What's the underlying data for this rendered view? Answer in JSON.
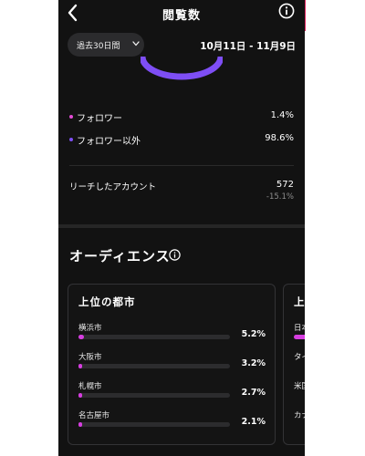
{
  "header": {
    "title": "閲覧数"
  },
  "filter": {
    "range_label": "過去30日間",
    "date_range": "10月11日 - 11月9日"
  },
  "breakdown": [
    {
      "label": "フォロワー",
      "value": "1.4%",
      "color": "#e44ad6"
    },
    {
      "label": "フォロワー以外",
      "value": "98.6%",
      "color": "#7e4ef5"
    }
  ],
  "reach": {
    "label": "リーチしたアカウント",
    "value": "572",
    "delta": "-15.1%"
  },
  "audience": {
    "title": "オーディエンス",
    "top_cities": {
      "title": "上位の都市",
      "items": [
        {
          "name": "横浜市",
          "pct": "5.2%",
          "share": 5.2
        },
        {
          "name": "大阪市",
          "pct": "3.2%",
          "share": 3.2
        },
        {
          "name": "札幌市",
          "pct": "2.7%",
          "share": 2.7
        },
        {
          "name": "名古屋市",
          "pct": "2.1%",
          "share": 2.1
        }
      ]
    },
    "second_card": {
      "title_partial": "上",
      "items": [
        "日本",
        "タイ",
        "米国",
        "カナ"
      ]
    }
  },
  "colors": {
    "accent": "#d63ee0",
    "arc": "#7e4ef5",
    "background": "#121212"
  },
  "icons": {
    "back": "chevron-left-icon",
    "info": "info-icon",
    "dropdown": "chevron-down-icon"
  }
}
